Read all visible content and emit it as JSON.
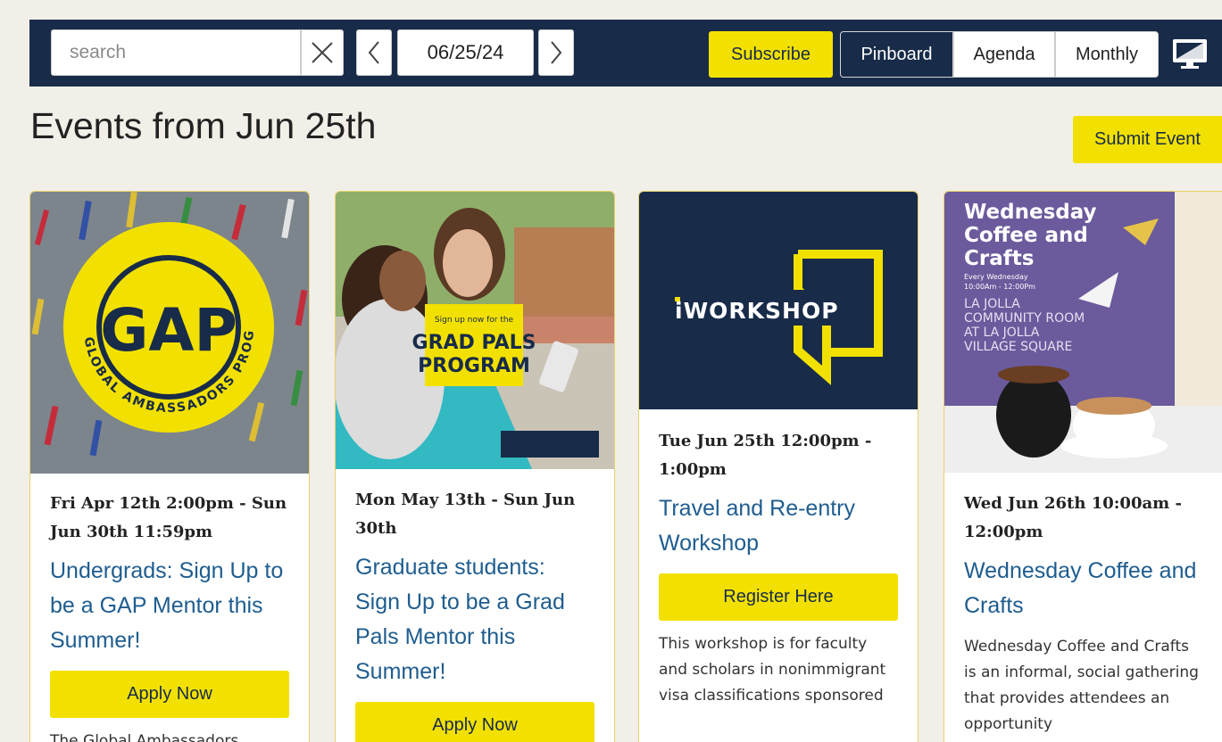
{
  "toolbar": {
    "search_placeholder": "search",
    "date": "06/25/24",
    "subscribe_label": "Subscribe",
    "views": [
      "Pinboard",
      "Agenda",
      "Monthly"
    ],
    "active_view": "Pinboard"
  },
  "page": {
    "title": "Events from Jun 25th",
    "submit_label": "Submit Event"
  },
  "events": [
    {
      "date": "Fri Apr 12th 2:00pm - Sun Jun 30th 11:59pm",
      "title": "Undergrads: Sign Up to be a GAP Mentor this Summer!",
      "button": "Apply Now",
      "description": "The Global Ambassadors",
      "image": {
        "logo_text": "GAP",
        "ring_text": "GLOBAL AMBASSADORS PROGRAM"
      }
    },
    {
      "date": "Mon May 13th - Sun Jun 30th",
      "title": "Graduate students: Sign Up to be a Grad Pals Mentor this Summer!",
      "button": "Apply Now",
      "description": "",
      "image": {
        "small_text": "Sign up now for the",
        "big_text_1": "GRAD PALS",
        "big_text_2": "PROGRAM"
      }
    },
    {
      "date": "Tue Jun 25th 12:00pm - 1:00pm",
      "title": "Travel and Re-entry Workshop",
      "button": "Register Here",
      "description": "This workshop is for faculty and scholars in nonimmigrant visa classifications sponsored",
      "image": {
        "logo_text": "iWORKSHOP"
      }
    },
    {
      "date": "Wed Jun 26th 10:00am - 12:00pm",
      "title": "Wednesday Coffee and Crafts",
      "button": "",
      "description": "Wednesday Coffee and Crafts is an informal, social gathering that provides attendees an opportunity",
      "image": {
        "title_lines": [
          "Wednesday",
          "Coffee and",
          "Crafts"
        ],
        "subtitle_lines": [
          "Every Wednesday",
          "10:00Am - 12:00Pm"
        ],
        "place_lines": [
          "LA JOLLA",
          "COMMUNITY ROOM",
          "AT LA JOLLA",
          "VILLAGE SQUARE"
        ]
      }
    }
  ],
  "colors": {
    "navy": "#182b49",
    "yellow": "#f2e100",
    "link_blue": "#1f5d8f",
    "page_bg": "#f1efe8"
  }
}
